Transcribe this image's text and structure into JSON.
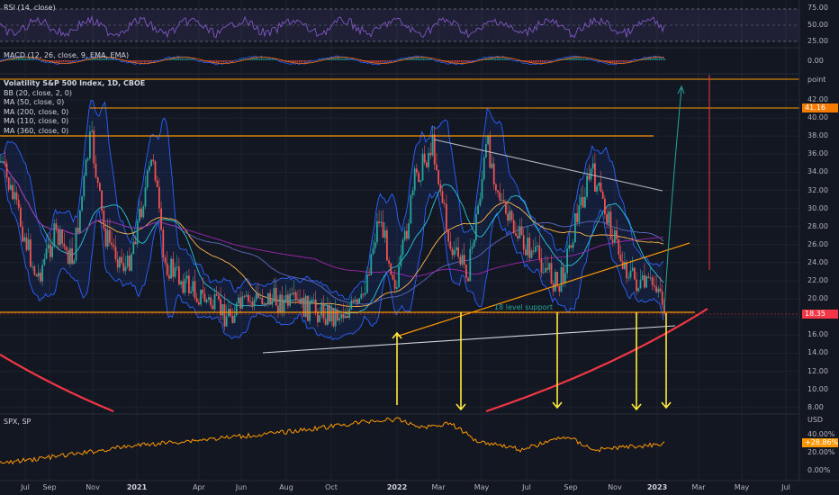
{
  "indicators": {
    "rsi": {
      "label": "RSI (14, close)",
      "levels": [
        "75.00",
        "50.00",
        "25.00"
      ]
    },
    "macd": {
      "label": "MACD (12, 26, close, 9, EMA, EMA)",
      "levels": [
        "0.00"
      ]
    }
  },
  "legend": {
    "title": "Volatility S&P 500 Index, 1D, CBOE",
    "lines": [
      "BB (20, close, 2, 0)",
      "MA (50, close, 0)",
      "MA (200, close, 0)",
      "MA (110, close, 0)",
      "MA (360, close, 0)"
    ]
  },
  "price_axis": {
    "unit": "point",
    "labels": [
      "42.00",
      "40.00",
      "38.00",
      "36.00",
      "34.00",
      "32.00",
      "30.00",
      "28.00",
      "26.00",
      "24.00",
      "22.00",
      "20.00",
      "18.00",
      "16.00",
      "14.00",
      "12.00",
      "10.00",
      "8.00"
    ],
    "price_tags": [
      {
        "text": "41.16",
        "color": "#f57c00"
      },
      {
        "text": "18.35",
        "color": "#f23645"
      }
    ]
  },
  "annotations": {
    "support_label": "18 level support"
  },
  "spx": {
    "label": "SPX, SP",
    "axis_unit": "USD",
    "levels": [
      "40.00%",
      "20.00%",
      "0.00%"
    ],
    "current_tag": "+28.86%"
  },
  "time_axis": [
    {
      "label": "Jul",
      "bold": false
    },
    {
      "label": "Sep",
      "bold": false
    },
    {
      "label": "Nov",
      "bold": false
    },
    {
      "label": "2021",
      "bold": true
    },
    {
      "label": "Apr",
      "bold": false
    },
    {
      "label": "Jun",
      "bold": false
    },
    {
      "label": "Aug",
      "bold": false
    },
    {
      "label": "Oct",
      "bold": false
    },
    {
      "label": "2022",
      "bold": true
    },
    {
      "label": "Mar",
      "bold": false
    },
    {
      "label": "May",
      "bold": false
    },
    {
      "label": "Jul",
      "bold": false
    },
    {
      "label": "Sep",
      "bold": false
    },
    {
      "label": "Nov",
      "bold": false
    },
    {
      "label": "2023",
      "bold": true
    },
    {
      "label": "Mar",
      "bold": false
    },
    {
      "label": "May",
      "bold": false
    },
    {
      "label": "Jul",
      "bold": false
    }
  ],
  "colors": {
    "background": "#131722",
    "candle_up": "#26a69a",
    "candle_down": "#ef5350",
    "bollinger": "#2962ff",
    "horizontal_level": "#ff9800",
    "arrow": "#ffeb3b",
    "curve": "#f23645",
    "spx_line": "#ff9800",
    "rsi_line": "#7e57c2"
  }
}
